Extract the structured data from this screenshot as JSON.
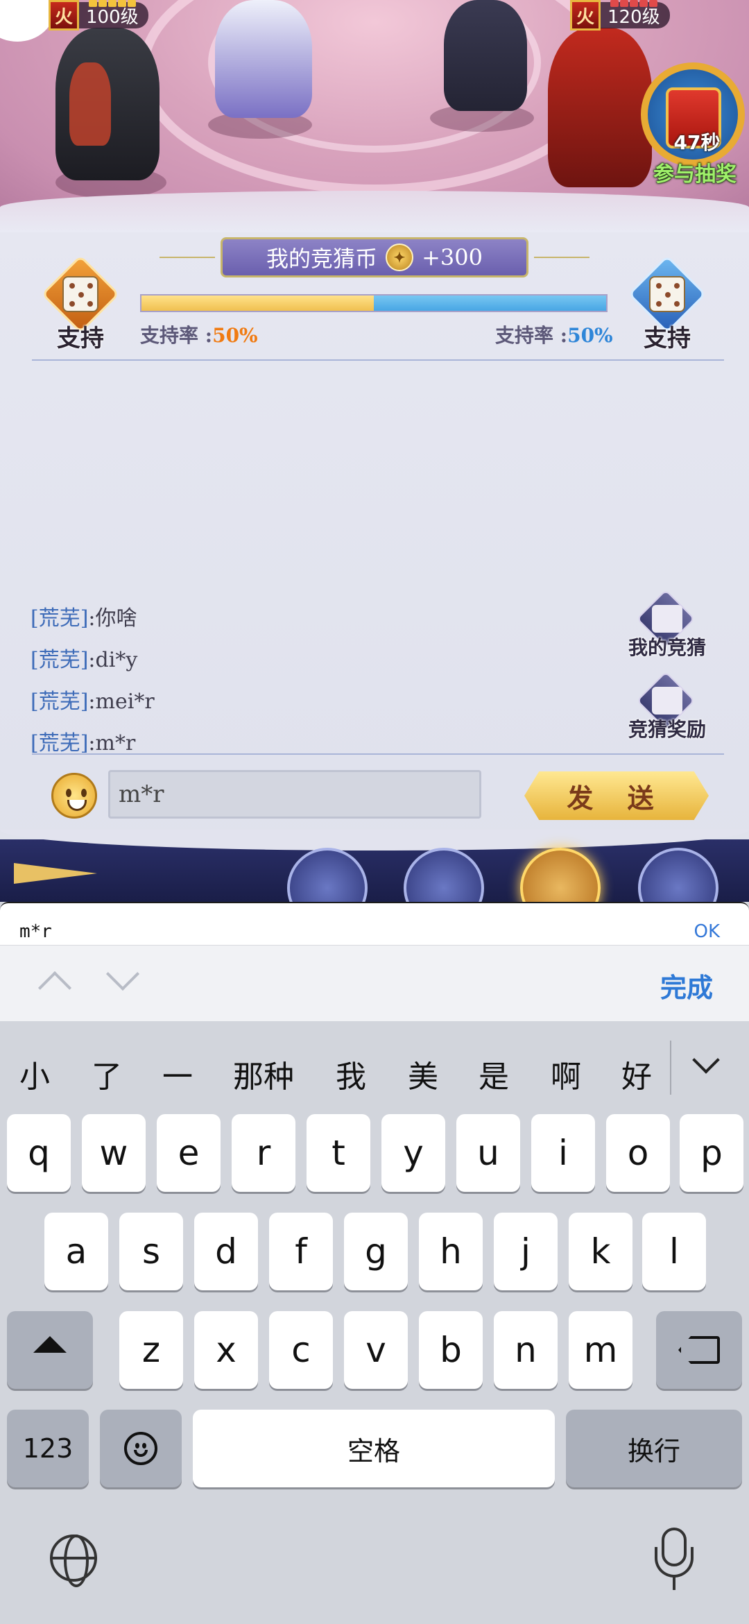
{
  "game": {
    "left_level": "100级",
    "right_level": "120级",
    "element_badge": "火",
    "lottery": {
      "timer": "47秒",
      "label": "参与抽奖"
    },
    "coin_banner": {
      "label": "我的竞猜币",
      "amount": "+300"
    },
    "support": {
      "left_label": "支持",
      "right_label": "支持",
      "left_rate_prefix": "支持率 :",
      "left_rate": "50%",
      "right_rate_prefix": "支持率 :",
      "right_rate": "50%",
      "left_fraction": 0.5,
      "right_fraction": 0.5,
      "left_color": "#f0c050",
      "right_color": "#48a6e4"
    },
    "chat": [
      {
        "channel": "[荒芜]",
        "text": ":你啥"
      },
      {
        "channel": "[荒芜]",
        "text": ":di*y"
      },
      {
        "channel": "[荒芜]",
        "text": ":mei*r"
      },
      {
        "channel": "[荒芜]",
        "text": ":m*r"
      }
    ],
    "side_buttons": {
      "my_guess": "我的竞猜",
      "guess_reward": "竞猜奖励"
    },
    "chat_input_value": "m*r",
    "send_label": "发 送"
  },
  "keyboard": {
    "input_bar_text": "m*r",
    "input_bar_ok": "OK",
    "done_label": "完成",
    "candidates": [
      "小",
      "了",
      "一",
      "那种",
      "我",
      "美",
      "是",
      "啊",
      "好"
    ],
    "row1": [
      "q",
      "w",
      "e",
      "r",
      "t",
      "y",
      "u",
      "i",
      "o",
      "p"
    ],
    "row2": [
      "a",
      "s",
      "d",
      "f",
      "g",
      "h",
      "j",
      "k",
      "l"
    ],
    "row3": [
      "z",
      "x",
      "c",
      "v",
      "b",
      "n",
      "m"
    ],
    "numbers_key": "123",
    "space_key": "空格",
    "return_key": "换行"
  }
}
